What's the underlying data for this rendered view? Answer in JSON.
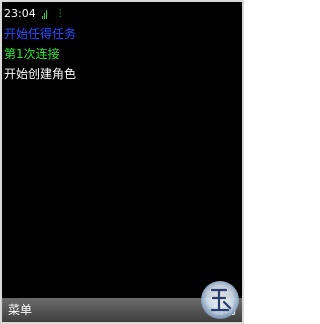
{
  "status": {
    "time": "23:04",
    "signal_icon": "signal-strength-icon"
  },
  "log": {
    "line1": "开始任得任务",
    "line2": "第1次连接",
    "line3": "开始创建角色"
  },
  "softkeys": {
    "left": "菜单",
    "right": "启动"
  },
  "colors": {
    "background": "#000000",
    "line1": "#2d4bff",
    "line2": "#2ee22e",
    "line3": "#ffffff",
    "softbar": "#555555"
  }
}
